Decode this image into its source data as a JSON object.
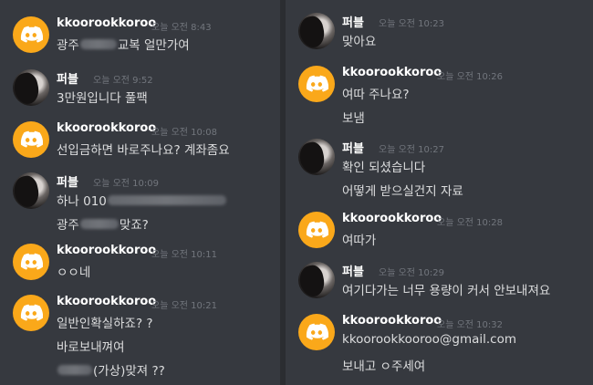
{
  "colors": {
    "background": "#36393f",
    "discord_avatar": "#faa81a",
    "username": "#ffffff",
    "timestamp": "#72767d",
    "message": "#dcddde"
  },
  "left": {
    "messages": [
      {
        "author": "kkoorookkoroo",
        "avatar": "discord-logo-icon",
        "time": "오늘 오전 8:43",
        "lines": [
          {
            "pre": "광주",
            "redacted": true,
            "post": "교복 얼만가여"
          }
        ]
      },
      {
        "author": "퍼블",
        "avatar": "user-photo",
        "time": "오늘 오전 9:52",
        "lines": [
          {
            "pre": "3만원입니다 풀팩"
          }
        ]
      },
      {
        "author": "kkoorookkoroo",
        "avatar": "discord-logo-icon",
        "time": "오늘 오전 10:08",
        "lines": [
          {
            "pre": "선입금하면 바로주나요? 계좌좀요"
          }
        ]
      },
      {
        "author": "퍼블",
        "avatar": "user-photo",
        "time": "오늘 오전 10:09",
        "lines": [
          {
            "pre": "하나 010",
            "redacted": true,
            "post": ""
          },
          {
            "pre": "광주",
            "redacted": true,
            "post": "맞죠?"
          }
        ]
      },
      {
        "author": "kkoorookkoroo",
        "avatar": "discord-logo-icon",
        "time": "오늘 오전 10:11",
        "lines": [
          {
            "pre": "ㅇㅇ네"
          }
        ]
      },
      {
        "author": "kkoorookkoroo",
        "avatar": "discord-logo-icon",
        "time": "오늘 오전 10:21",
        "lines": [
          {
            "pre": "일반인확실하죠? ?"
          },
          {
            "pre": "바로보내껴여"
          },
          {
            "pre": "",
            "redacted": true,
            "post": "(가상)맞져 ??"
          }
        ]
      }
    ]
  },
  "right": {
    "messages": [
      {
        "author": "퍼블",
        "avatar": "user-photo",
        "time": "오늘 오전 10:23",
        "lines": [
          {
            "pre": "맞아요"
          }
        ]
      },
      {
        "author": "kkoorookkoroo",
        "avatar": "discord-logo-icon",
        "time": "오늘 오전 10:26",
        "lines": [
          {
            "pre": "여따 주나요?"
          },
          {
            "pre": "보냄"
          }
        ]
      },
      {
        "author": "퍼블",
        "avatar": "user-photo",
        "time": "오늘 오전 10:27",
        "lines": [
          {
            "pre": "확인 되셨습니다"
          },
          {
            "pre": "어떻게 받으실건지 자료"
          }
        ]
      },
      {
        "author": "kkoorookkoroo",
        "avatar": "discord-logo-icon",
        "time": "오늘 오전 10:28",
        "lines": [
          {
            "pre": "여따가"
          }
        ]
      },
      {
        "author": "퍼블",
        "avatar": "user-photo",
        "time": "오늘 오전 10:29",
        "lines": [
          {
            "pre": "여기다가는 너무 용량이 커서 안보내져요"
          }
        ]
      },
      {
        "author": "kkoorookkoroo",
        "avatar": "discord-logo-icon",
        "time": "오늘 오전 10:32",
        "lines": [
          {
            "pre": "kkoorookkooroo@gmail.com"
          },
          {
            "pre": "보내고 ㅇ주세여"
          }
        ]
      }
    ]
  }
}
